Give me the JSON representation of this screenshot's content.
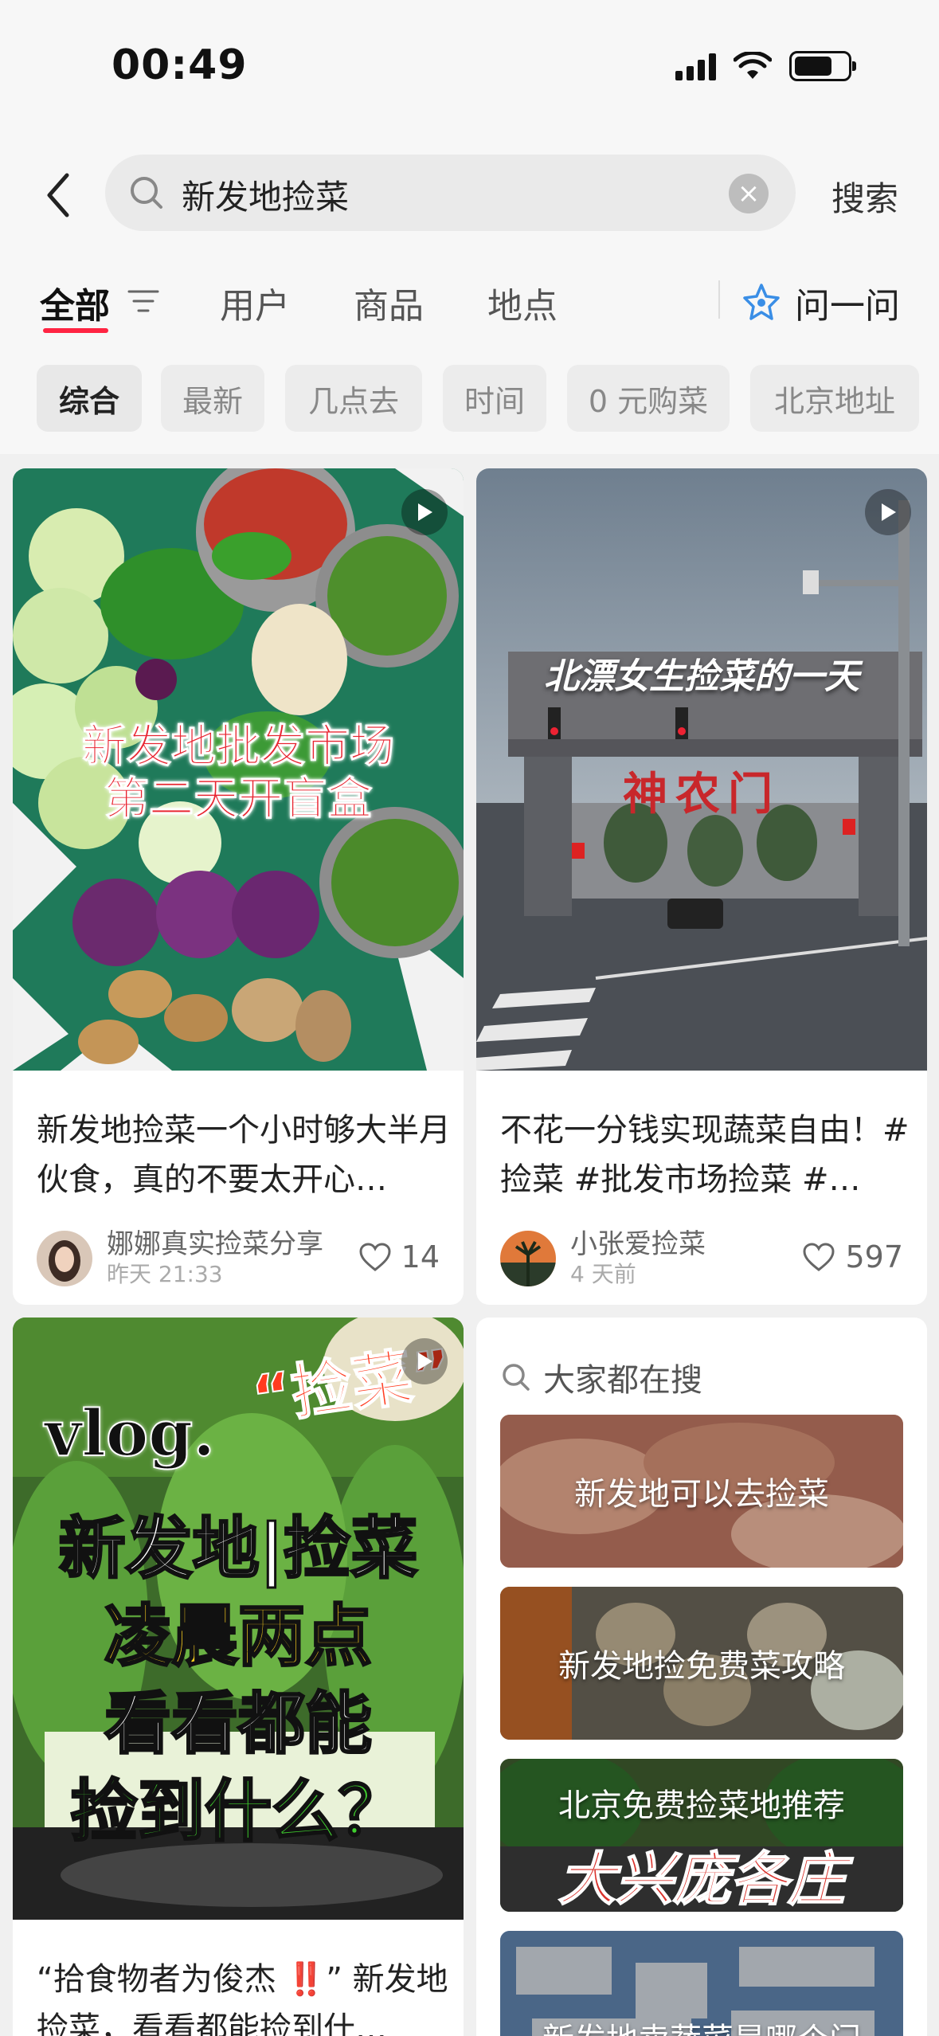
{
  "status_bar": {
    "time": "00:49"
  },
  "search": {
    "query": "新发地捡菜",
    "submit_label": "搜索"
  },
  "tabs": [
    {
      "label": "全部",
      "active": true
    },
    {
      "label": "用户"
    },
    {
      "label": "商品"
    },
    {
      "label": "地点"
    }
  ],
  "ask": {
    "label": "问一问"
  },
  "chips": [
    {
      "label": "综合",
      "active": true
    },
    {
      "label": "最新"
    },
    {
      "label": "几点去"
    },
    {
      "label": "时间"
    },
    {
      "label": "0 元购菜"
    },
    {
      "label": "北京地址"
    }
  ],
  "posts": [
    {
      "cover_text_1": "新发地批发市场",
      "cover_text_2": "第二天开盲盒",
      "title": "新发地捡菜一个小时够大半月伙食，真的不要太开心…",
      "author": "娜娜真实捡菜分享",
      "date": "昨天 21:33",
      "likes": "14"
    },
    {
      "cover_text_1": "北漂女生捡菜的一天",
      "cover_sign": "神农门",
      "title": "不花一分钱实现蔬菜自由！#捡菜 #批发市场捡菜 #…",
      "author": "小张爱捡菜",
      "date": "4 天前",
      "likes": "597"
    },
    {
      "cover_vlog": "vlog.",
      "cover_quote": "“捡菜”",
      "cover_line_1": "新发地|捡菜",
      "cover_line_2": "凌晨两点",
      "cover_line_3": "看看都能",
      "cover_line_4": "捡到什么？",
      "title": "“拾食物者为俊杰 ‼️” 新发地捡菜，看看都能捡到什…"
    }
  ],
  "trending": {
    "header": "大家都在搜",
    "items": [
      {
        "label": "新发地可以去捡菜"
      },
      {
        "label": "新发地捡免费菜攻略"
      },
      {
        "label": "北京免费捡菜地推荐"
      },
      {
        "label": "新发地卖蔬菜是哪个门"
      }
    ],
    "item_3_cover_text": "大兴庞各庄"
  },
  "colors": {
    "accent": "#ff2442",
    "ask_icon": "#3a8ee6"
  }
}
